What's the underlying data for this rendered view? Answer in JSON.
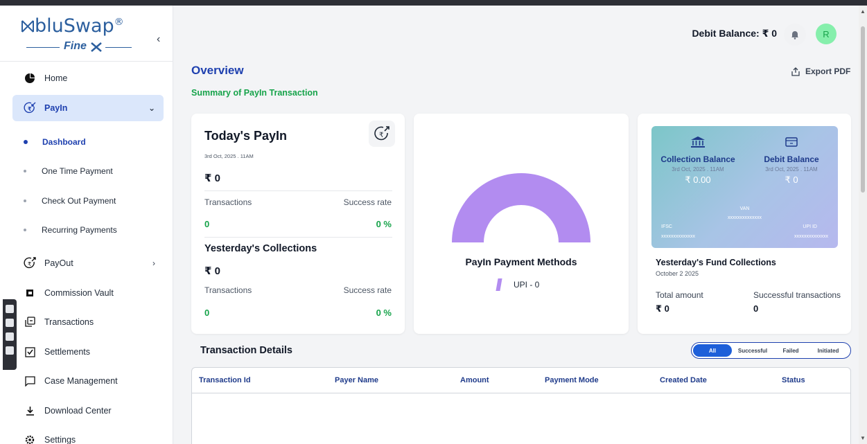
{
  "brand": {
    "name": "bluSwap",
    "registered": "®",
    "sub": "Fine"
  },
  "sidebar": {
    "items": [
      {
        "label": "Home",
        "icon": "pie-chart-icon"
      },
      {
        "label": "PayIn",
        "icon": "rupee-in-icon",
        "active": true
      },
      {
        "label": "PayOut",
        "icon": "rupee-out-icon"
      },
      {
        "label": "Commission Vault",
        "icon": "vault-icon"
      },
      {
        "label": "Transactions",
        "icon": "transactions-icon"
      },
      {
        "label": "Settlements",
        "icon": "checkbox-icon"
      },
      {
        "label": "Case Management",
        "icon": "chat-icon"
      },
      {
        "label": "Download Center",
        "icon": "download-icon"
      },
      {
        "label": "Settings",
        "icon": "gear-icon"
      }
    ],
    "payin_sub": [
      "Dashboard",
      "One Time Payment",
      "Check Out Payment",
      "Recurring Payments"
    ]
  },
  "header": {
    "debit_label": "Debit Balance: ₹ 0",
    "avatar_initial": "R"
  },
  "overview": {
    "title": "Overview",
    "summary": "Summary of PayIn Transaction",
    "export": "Export PDF"
  },
  "today": {
    "title": "Today's PayIn",
    "date": "3rd Oct, 2025 . 11AM",
    "amount": "₹ 0",
    "transactions_label": "Transactions",
    "success_label": "Success rate",
    "transactions": "0",
    "success": "0 %"
  },
  "yesterday": {
    "title": "Yesterday's Collections",
    "amount": "₹ 0",
    "transactions_label": "Transactions",
    "success_label": "Success rate",
    "transactions": "0",
    "success": "0 %"
  },
  "methods": {
    "title": "PayIn Payment Methods",
    "legend": "UPI - 0",
    "color": "#b28cf0"
  },
  "balance_card": {
    "collection": {
      "label": "Collection Balance",
      "date": "3rd Oct, 2025 . 11AM",
      "value": "₹ 0.00"
    },
    "debit": {
      "label": "Debit Balance",
      "date": "3rd Oct, 2025 . 11AM",
      "value": "₹ 0"
    },
    "van_label": "VAN",
    "van_value": "xxxxxxxxxxxxxx",
    "ifsc_label": "IFSC",
    "ifsc_value": "xxxxxxxxxxxxxx",
    "upi_label": "UPI ID",
    "upi_value": "xxxxxxxxxxxxxx"
  },
  "fund": {
    "title": "Yesterday's Fund Collections",
    "date": "October 2 2025",
    "total_label": "Total amount",
    "total_value": "₹ 0",
    "success_label": "Successful transactions",
    "success_value": "0"
  },
  "transactions": {
    "title": "Transaction Details",
    "filters": [
      "All",
      "Successful",
      "Failed",
      "Initiated"
    ],
    "selected_filter": "All",
    "columns": [
      "Transaction Id",
      "Payer Name",
      "Amount",
      "Payment Mode",
      "Created Date",
      "Status"
    ]
  },
  "colors": {
    "primary": "#1e40af",
    "success": "#16a34a",
    "accent": "#1e5fd9"
  }
}
